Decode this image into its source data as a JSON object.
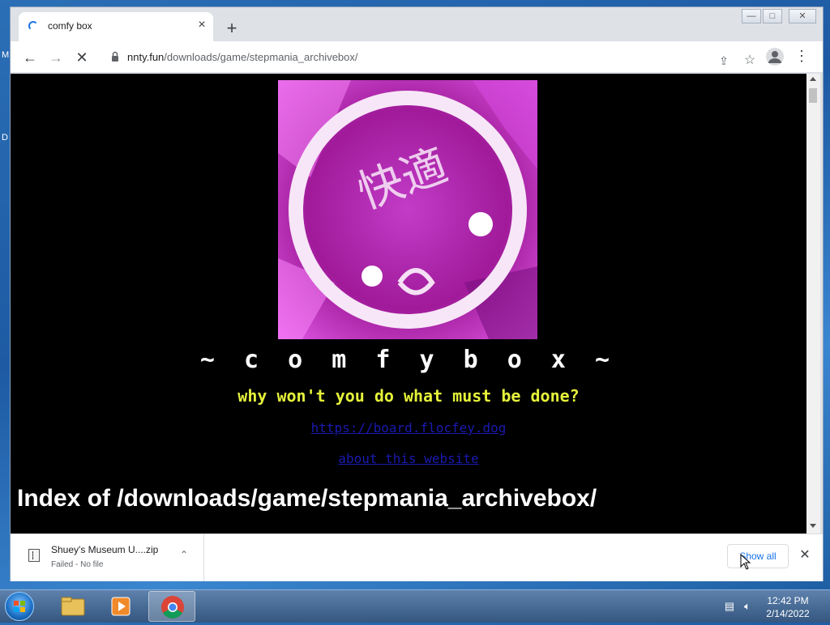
{
  "desktop": {
    "left_fragments": [
      "M",
      "D"
    ]
  },
  "window": {
    "controls": {
      "minimize": "—",
      "maximize": "□",
      "close": "✕"
    }
  },
  "tab": {
    "title": "comfy box",
    "close_glyph": "×"
  },
  "newtab_glyph": "+",
  "toolbar": {
    "back_glyph": "←",
    "forward_glyph": "→",
    "stop_glyph": "✕",
    "url_host": "nnty.fun",
    "url_path": "/downloads/game/stepmania_archivebox/",
    "share_glyph": "⇪",
    "bookmark_glyph": "☆",
    "menu_glyph": "⋮"
  },
  "page": {
    "title": "~ c o m f y   b o x ~",
    "tagline": "why won't you do what must be done?",
    "link1": "https://board.flocfey.dog",
    "link2": "about this website",
    "index_heading": "Index of /downloads/game/stepmania_archivebox/",
    "logo_text": "快適"
  },
  "downloads": {
    "item_name": "Shuey's Museum U....zip",
    "item_status": "Failed - No file",
    "chevron_glyph": "⌃",
    "show_all": "Show all",
    "close_glyph": "✕"
  },
  "taskbar": {
    "time": "12:42 PM",
    "date": "2/14/2022"
  },
  "colors": {
    "tagline": "#e5f23a",
    "link": "#1a1ab0",
    "accent": "#1a73e8"
  }
}
